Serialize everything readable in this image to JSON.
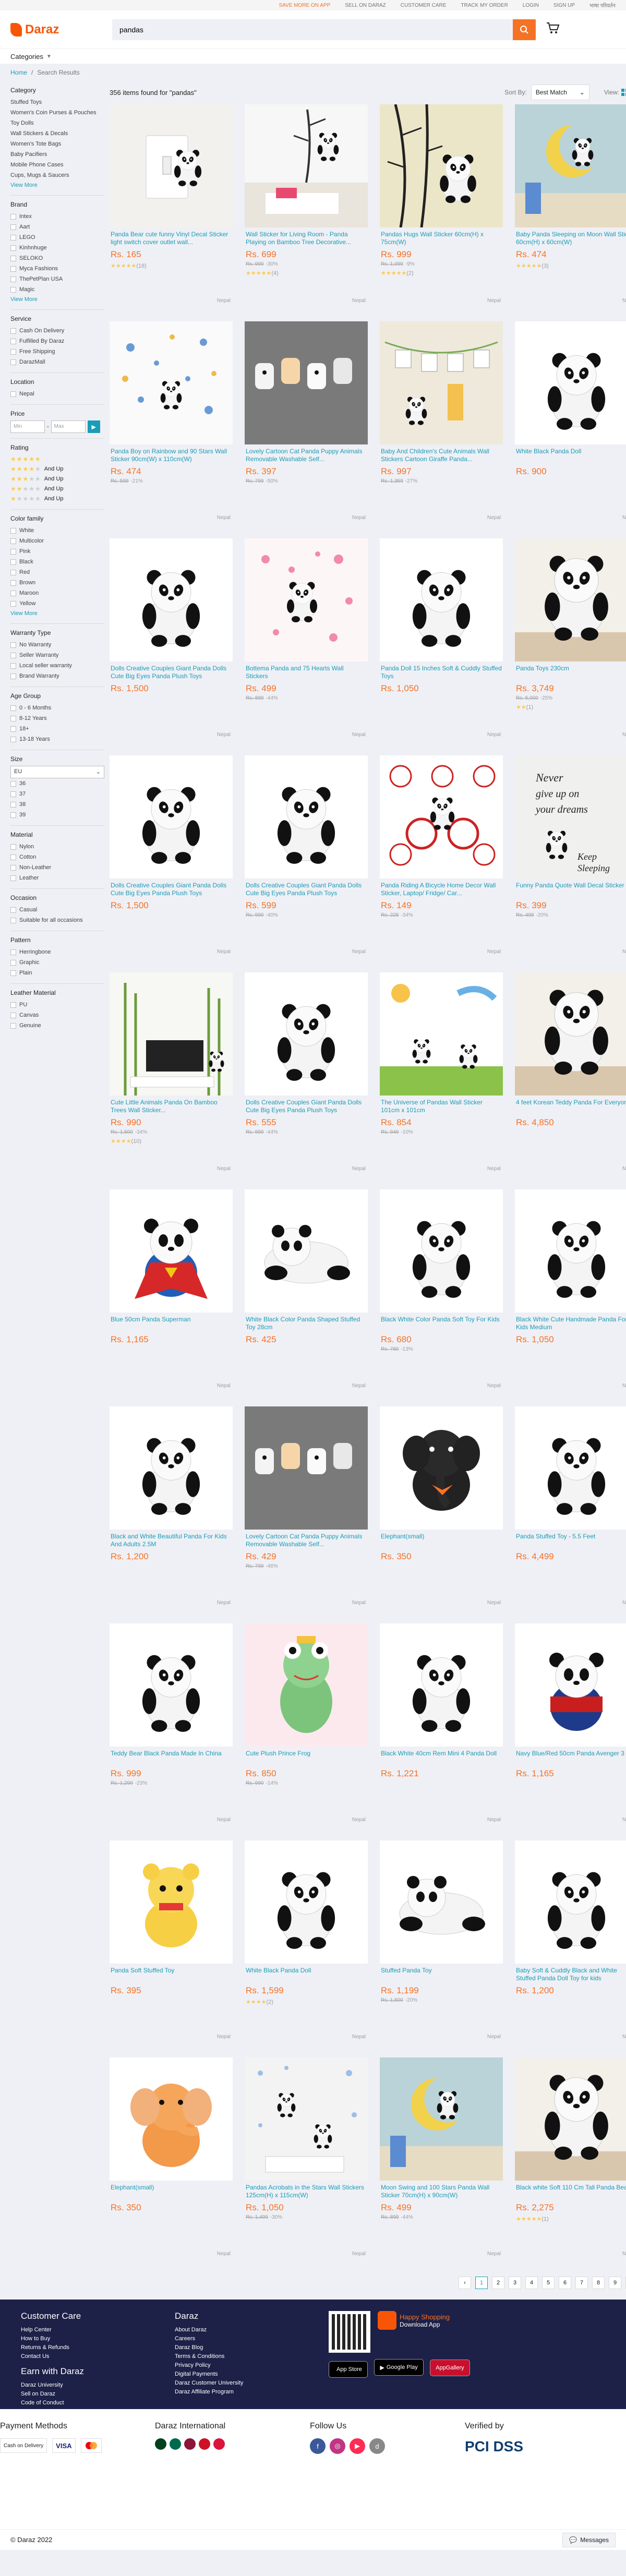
{
  "topbar": {
    "save_more": "SAVE MORE ON APP",
    "sell": "SELL ON DARAZ",
    "care": "CUSTOMER CARE",
    "track": "TRACK MY ORDER",
    "login": "LOGIN",
    "signup": "SIGN UP",
    "lang": "भाषा परिवर्तन"
  },
  "header": {
    "logo": "Daraz",
    "search_value": "pandas",
    "categories": "Categories"
  },
  "breadcrumb": {
    "home": "Home",
    "current": "Search Results"
  },
  "results": {
    "count_text": "356 items found for \"pandas\"",
    "sort_label": "Sort By:",
    "sort_value": "Best Match",
    "view_label": "View:"
  },
  "sidebar": {
    "category_title": "Category",
    "categories": [
      "Stuffed Toys",
      "Women's Coin Purses & Pouches",
      "Toy Dolls",
      "Wall Stickers & Decals",
      "Women's Tote Bags",
      "Baby Pacifiers",
      "Mobile Phone Cases",
      "Cups, Mugs & Saucers"
    ],
    "view_more": "View More",
    "brand_title": "Brand",
    "brands": [
      "Intex",
      "Aart",
      "LEGO",
      "Kinhnhuge",
      "SELOKO",
      "Myca Fashions",
      "ThePetPlan USA",
      "Magic"
    ],
    "service_title": "Service",
    "services": [
      "Cash On Delivery",
      "Fulfilled By Daraz",
      "Free Shipping",
      "DarazMall"
    ],
    "location_title": "Location",
    "locations": [
      "Nepal"
    ],
    "price_title": "Price",
    "price_min": "Min",
    "price_max": "Max",
    "price_go": "▶",
    "rating_title": "Rating",
    "ratings": [
      {
        "stars": 5,
        "text": ""
      },
      {
        "stars": 4,
        "text": "And Up"
      },
      {
        "stars": 3,
        "text": "And Up"
      },
      {
        "stars": 2,
        "text": "And Up"
      },
      {
        "stars": 1,
        "text": "And Up"
      }
    ],
    "color_title": "Color family",
    "colors": [
      "White",
      "Multicolor",
      "Pink",
      "Black",
      "Red",
      "Brown",
      "Maroon",
      "Yellow"
    ],
    "warranty_title": "Warranty Type",
    "warranties": [
      "No Warranty",
      "Seller Warranty",
      "Local seller warranty",
      "Brand Warranty"
    ],
    "age_title": "Age Group",
    "ages": [
      "0 - 6 Months",
      "8-12 Years",
      "18+",
      "13-18 Years"
    ],
    "size_title": "Size",
    "size_select": "EU",
    "sizes": [
      "36",
      "37",
      "38",
      "39"
    ],
    "material_title": "Material",
    "materials": [
      "Nylon",
      "Cotton",
      "Non-Leather",
      "Leather"
    ],
    "occasion_title": "Occasion",
    "occasions": [
      "Casual",
      "Suitable for all occasions"
    ],
    "pattern_title": "Pattern",
    "patterns": [
      "Herringbone",
      "Graphic",
      "Plain"
    ],
    "leather_title": "Leather Material",
    "leathers": [
      "PU",
      "Canvas",
      "Genuine"
    ]
  },
  "products": [
    {
      "title": "Panda Bear cute funny Vinyl Decal Sticker light switch cover outlet wall...",
      "price": "Rs. 165",
      "orig": "",
      "disc": "",
      "rating": "★★★★★",
      "count": "(18)",
      "loc": "Nepal",
      "img": "switch"
    },
    {
      "title": "Wall Sticker for Living Room - Panda Playing on Bamboo Tree Decorative...",
      "price": "Rs. 699",
      "orig": "Rs. 999",
      "disc": "-30%",
      "rating": "★★★★★",
      "count": "(4)",
      "loc": "Nepal",
      "img": "bamboo"
    },
    {
      "title": "Pandas Hugs Wall Sticker 60cm(H) x 75cm(W)",
      "price": "Rs. 999",
      "orig": "Rs. 1,099",
      "disc": "-9%",
      "rating": "★★★★★",
      "count": "(2)",
      "loc": "Nepal",
      "img": "hug"
    },
    {
      "title": "Baby Panda Sleeping on Moon Wall Sticker 60cm(H) x 60cm(W)",
      "price": "Rs. 474",
      "orig": "",
      "disc": "",
      "rating": "★★★★★",
      "count": "(3)",
      "loc": "Nepal",
      "img": "moon"
    },
    {
      "title": "Panda Boy on Rainbow and 90 Stars Wall Sticker 90cm(W) x 110cm(W)",
      "price": "Rs. 474",
      "orig": "Rs. 599",
      "disc": "-21%",
      "rating": "",
      "count": "",
      "loc": "Nepal",
      "img": "stars"
    },
    {
      "title": "Lovely Cartoon Cat Panda Puppy Animals Removable Washable Self...",
      "price": "Rs. 397",
      "orig": "Rs. 799",
      "disc": "-50%",
      "rating": "",
      "count": "",
      "loc": "Nepal",
      "img": "hooks"
    },
    {
      "title": "Baby And Children's Cute Animals Wall Stickers Cartoon Giraffe Panda...",
      "price": "Rs. 997",
      "orig": "Rs. 1,359",
      "disc": "-27%",
      "rating": "",
      "count": "",
      "loc": "Nepal",
      "img": "cartoon"
    },
    {
      "title": "White Black Panda Doll",
      "price": "Rs. 900",
      "orig": "",
      "disc": "",
      "rating": "",
      "count": "",
      "loc": "Nepal",
      "img": "plush"
    },
    {
      "title": "Dolls Creative Couples Giant Panda Dolls Cute Big Eyes Panda Plush Toys",
      "price": "Rs. 1,500",
      "orig": "",
      "disc": "",
      "rating": "",
      "count": "",
      "loc": "Nepal",
      "img": "plush"
    },
    {
      "title": "Bottema Panda and 75 Hearts Wall Stickers",
      "price": "Rs. 499",
      "orig": "Rs. 899",
      "disc": "-44%",
      "rating": "",
      "count": "",
      "loc": "Nepal",
      "img": "hearts"
    },
    {
      "title": "Panda Doll 15 Inches Soft & Cuddly Stuffed Toys",
      "price": "Rs. 1,050",
      "orig": "",
      "disc": "",
      "rating": "",
      "count": "",
      "loc": "Nepal",
      "img": "plush"
    },
    {
      "title": "Panda Toys 230cm",
      "price": "Rs. 3,749",
      "orig": "Rs. 5,000",
      "disc": "-25%",
      "rating": "★★",
      "count": "(1)",
      "loc": "Nepal",
      "img": "giant"
    },
    {
      "title": "Dolls Creative Couples Giant Panda Dolls Cute Big Eyes Panda Plush Toys",
      "price": "Rs. 1,500",
      "orig": "",
      "disc": "",
      "rating": "",
      "count": "",
      "loc": "Nepal",
      "img": "plush"
    },
    {
      "title": "Dolls Creative Couples Giant Panda Dolls Cute Big Eyes Panda Plush Toys",
      "price": "Rs. 599",
      "orig": "Rs. 999",
      "disc": "-40%",
      "rating": "",
      "count": "",
      "loc": "Nepal",
      "img": "plush"
    },
    {
      "title": "Panda Riding A Bicycle Home Decor Wall Sticker, Laptop/ Fridge/ Car...",
      "price": "Rs. 149",
      "orig": "Rs. 225",
      "disc": "-34%",
      "rating": "",
      "count": "",
      "loc": "Nepal",
      "img": "bicycle"
    },
    {
      "title": "Funny Panda Quote Wall Decal Sticker - ...",
      "price": "Rs. 399",
      "orig": "Rs. 499",
      "disc": "-20%",
      "rating": "",
      "count": "",
      "loc": "Nepal",
      "img": "quote"
    },
    {
      "title": "Cute Little Animals Panda On Bamboo Trees Wall Sticker...",
      "price": "Rs. 990",
      "orig": "Rs. 1,500",
      "disc": "-34%",
      "rating": "★★★★",
      "count": "(10)",
      "loc": "Nepal",
      "img": "tv"
    },
    {
      "title": "Dolls Creative Couples Giant Panda Dolls Cute Big Eyes Panda Plush Toys",
      "price": "Rs. 555",
      "orig": "Rs. 999",
      "disc": "-44%",
      "rating": "",
      "count": "",
      "loc": "Nepal",
      "img": "plush"
    },
    {
      "title": "The Universe of Pandas Wall Sticker 101cm x 101cm",
      "price": "Rs. 854",
      "orig": "Rs. 949",
      "disc": "-10%",
      "rating": "",
      "count": "",
      "loc": "Nepal",
      "img": "universe"
    },
    {
      "title": "4 feet Korean Teddy Panda For Everyone",
      "price": "Rs. 4,850",
      "orig": "",
      "disc": "",
      "rating": "",
      "count": "",
      "loc": "Nepal",
      "img": "giant"
    },
    {
      "title": "Blue 50cm Panda Superman",
      "price": "Rs. 1,165",
      "orig": "",
      "disc": "",
      "rating": "",
      "count": "",
      "loc": "Nepal",
      "img": "superman"
    },
    {
      "title": "White Black Color Panda Shaped Stuffed Toy 28cm",
      "price": "Rs. 425",
      "orig": "",
      "disc": "",
      "rating": "",
      "count": "",
      "loc": "Nepal",
      "img": "lying"
    },
    {
      "title": "Black White Color Panda Soft Toy For Kids",
      "price": "Rs. 680",
      "orig": "Rs. 780",
      "disc": "-13%",
      "rating": "",
      "count": "",
      "loc": "Nepal",
      "img": "plush"
    },
    {
      "title": "Black White Cute Handmade Panda For Kids Medium",
      "price": "Rs. 1,050",
      "orig": "",
      "disc": "",
      "rating": "",
      "count": "",
      "loc": "Nepal",
      "img": "plush"
    },
    {
      "title": "Black and White Beautiful Panda For Kids And Adults 2.5M",
      "price": "Rs. 1,200",
      "orig": "",
      "disc": "",
      "rating": "",
      "count": "",
      "loc": "Nepal",
      "img": "plush"
    },
    {
      "title": "Lovely Cartoon Cat Panda Puppy Animals Removable Washable Self...",
      "price": "Rs. 429",
      "orig": "Rs. 799",
      "disc": "-46%",
      "rating": "",
      "count": "",
      "loc": "Nepal",
      "img": "hooks"
    },
    {
      "title": "Elephant(small)",
      "price": "Rs. 350",
      "orig": "",
      "disc": "",
      "rating": "",
      "count": "",
      "loc": "Nepal",
      "img": "elephant-black"
    },
    {
      "title": "Panda Stuffed Toy - 5.5 Feet",
      "price": "Rs. 4,499",
      "orig": "",
      "disc": "",
      "rating": "",
      "count": "",
      "loc": "Nepal",
      "img": "plush"
    },
    {
      "title": "Teddy Bear Black Panda Made In China",
      "price": "Rs. 999",
      "orig": "Rs. 1,299",
      "disc": "-23%",
      "rating": "",
      "count": "",
      "loc": "Nepal",
      "img": "plush"
    },
    {
      "title": "Cute Plush Prince Frog",
      "price": "Rs. 850",
      "orig": "Rs. 990",
      "disc": "-14%",
      "rating": "",
      "count": "",
      "loc": "Nepal",
      "img": "frog"
    },
    {
      "title": "Black White 40cm Rem Mini 4 Panda Doll",
      "price": "Rs. 1,221",
      "orig": "",
      "disc": "",
      "rating": "",
      "count": "",
      "loc": "Nepal",
      "img": "plush"
    },
    {
      "title": "Navy Blue/Red 50cm Panda Avenger 3",
      "price": "Rs. 1,165",
      "orig": "",
      "disc": "",
      "rating": "",
      "count": "",
      "loc": "Nepal",
      "img": "avenger"
    },
    {
      "title": "Panda Soft Stuffed Toy",
      "price": "Rs. 395",
      "orig": "",
      "disc": "",
      "rating": "",
      "count": "",
      "loc": "Nepal",
      "img": "yellow"
    },
    {
      "title": "White Black Panda Doll",
      "price": "Rs. 1,599",
      "orig": "",
      "disc": "",
      "rating": "★★★★",
      "count": "(2)",
      "loc": "Nepal",
      "img": "plush"
    },
    {
      "title": "Stuffed Panda Toy",
      "price": "Rs. 1,199",
      "orig": "Rs. 1,500",
      "disc": "-20%",
      "rating": "",
      "count": "",
      "loc": "Nepal",
      "img": "lying"
    },
    {
      "title": "Baby Soft & Cuddly Black and White Stuffed Panda Doll Toy for kids",
      "price": "Rs. 1,200",
      "orig": "",
      "disc": "",
      "rating": "",
      "count": "",
      "loc": "Nepal",
      "img": "plush"
    },
    {
      "title": "Elephant(small)",
      "price": "Rs. 350",
      "orig": "",
      "disc": "",
      "rating": "",
      "count": "",
      "loc": "Nepal",
      "img": "elephant-orange"
    },
    {
      "title": "Pandas Acrobats in the Stars Wall Stickers 125cm(H) x 115cm(W)",
      "price": "Rs. 1,050",
      "orig": "Rs. 1,499",
      "disc": "-30%",
      "rating": "",
      "count": "",
      "loc": "Nepal",
      "img": "acrobats"
    },
    {
      "title": "Moon Swing and 100 Stars Panda Wall Sticker 70cm(H) x 90cm(W)",
      "price": "Rs. 499",
      "orig": "Rs. 899",
      "disc": "-44%",
      "rating": "",
      "count": "",
      "loc": "Nepal",
      "img": "moon"
    },
    {
      "title": "Black white Soft 110 Cm Tall Panda Bear",
      "price": "Rs. 2,275",
      "orig": "",
      "disc": "",
      "rating": "★★★★★",
      "count": "(1)",
      "loc": "Nepal",
      "img": "giant"
    }
  ],
  "pagination": [
    "‹",
    "1",
    "2",
    "3",
    "4",
    "5",
    "6",
    "7",
    "8",
    "9",
    "›"
  ],
  "footer": {
    "care_title": "Customer Care",
    "care_links": [
      "Help Center",
      "How to Buy",
      "Returns & Refunds",
      "Contact Us"
    ],
    "earn_title": "Earn with Daraz",
    "earn_links": [
      "Daraz University",
      "Sell on Daraz",
      "Code of Conduct"
    ],
    "daraz_title": "Daraz",
    "daraz_links": [
      "About Daraz",
      "Careers",
      "Daraz Blog",
      "Terms & Conditions",
      "Privacy Policy",
      "Digital Payments",
      "Daraz Customer University",
      "Daraz Affiliate Program"
    ],
    "happy": "Happy Shopping",
    "download": "Download App",
    "appstore": "App Store",
    "googleplay": "Google Play",
    "appgallery": "AppGallery",
    "payment_title": "Payment Methods",
    "payments": [
      "Cash on Delivery",
      "VISA",
      "Mastercard"
    ],
    "intl_title": "Daraz International",
    "follow_title": "Follow Us",
    "verified_title": "Verified by",
    "pci": "PCI DSS",
    "copyright": "© Daraz 2022",
    "messages": "Messages"
  },
  "colors": {
    "accent": "#f57224",
    "brand": "#f85606",
    "link": "#1a9cb7",
    "footer_bg": "#1d2047"
  }
}
